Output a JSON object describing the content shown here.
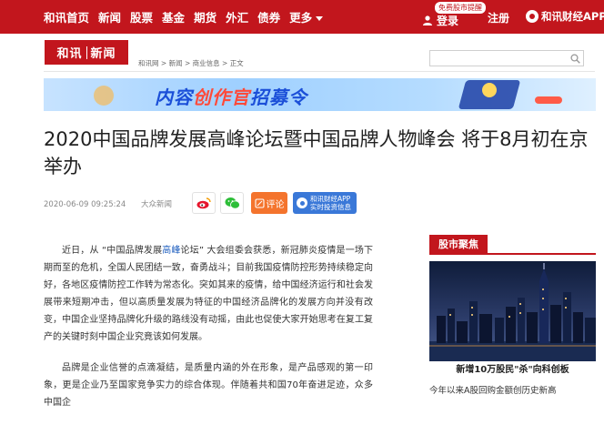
{
  "nav": {
    "items": [
      "和讯首页",
      "新闻",
      "股票",
      "基金",
      "期货",
      "外汇",
      "债券",
      "更多"
    ],
    "login_badge": "免费股市提醒",
    "login": "登录",
    "register": "注册",
    "app": "和讯财经APP"
  },
  "header": {
    "logo_left": "和讯",
    "logo_right": "新闻",
    "breadcrumb": [
      "和讯网",
      "新闻",
      "商业信息",
      "正文"
    ],
    "breadcrumb_sep": " > "
  },
  "banner": {
    "text_a": "内容",
    "text_b": "创作官",
    "text_c": "招募令"
  },
  "article": {
    "title": "2020中国品牌发展高峰论坛暨中国品牌人物峰会 将于8月初在京举办",
    "date": "2020-06-09 09:25:24",
    "source": "大众新闻",
    "comment_label": "评论",
    "app_btn_line1": "和讯财经APP",
    "app_btn_line2": "实时投资信息",
    "p1_a": "近日，从 “中国品牌发展",
    "p1_kw": "高峰",
    "p1_b": "论坛” 大会组委会获悉，新冠肺炎疫情是一场下期而至的危机，全国人民团结一致，奋勇战斗；目前我国疫情防控形势持续稳定向好，各地区疫情防控工作转为常态化。突如其来的疫情，给中国经济运行和社会发展带来短期冲击，但以高质量发展为特征的中国经济品牌化的发展方向并没有改变，中国企业坚持品牌化升级的路线没有动摇，由此也促使大家开始思考在复工复产的关键时刻中国企业究竟该如何发展。",
    "p2": "品牌是企业信誉的点滴凝结，是质量内涵的外在形象，是产品感观的第一印象，更是企业乃至国家竞争实力的综合体现。伴随着共和国70年奋进足迹，众多中国企"
  },
  "sidebar": {
    "tab": "股市聚焦",
    "caption": "新增10万股民\"杀\"向科创板",
    "news": "今年以来A股回购金额创历史新高"
  },
  "colors": {
    "brand_red": "#c2161d",
    "link_blue": "#1f5fbf",
    "comment_orange": "#f4742d",
    "app_blue": "#3a78d8"
  }
}
